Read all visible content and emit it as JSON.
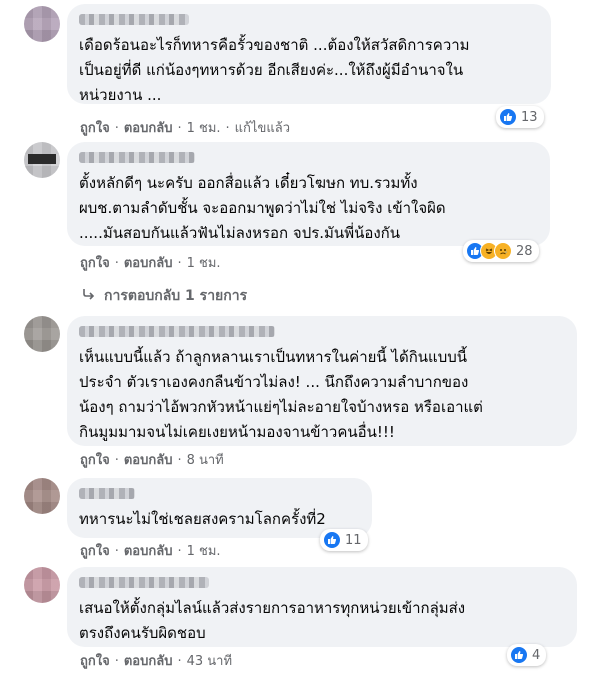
{
  "colors": {
    "bubble": "#f0f2f5",
    "secondary_text": "#65676b",
    "like_blue": "#1877f2",
    "emoji_yellow": "#f7b125"
  },
  "actions": {
    "like": "ถูกใจ",
    "reply": "ตอบกลับ",
    "separator": "·"
  },
  "comments": [
    {
      "text": "เดือดร้อนอะไรก็ทหารคือรั้วของชาติ ...ต้องให้สวัสดิการความ\nเป็นอยู่ที่ดี แก่น้องๆทหารด้วย อีกเสียงค่ะ...ให้ถึงผู้มีอำนาจใน\nหน่วยงาน ...",
      "time": "1 ชม.",
      "edited": "แก้ไขแล้ว",
      "reaction_icons": [
        "like-icon"
      ],
      "reaction_count": "13"
    },
    {
      "text": "ตั้งหลักดีๆ นะครับ ออกสื่อแล้ว เดี๋ยวโฆษก ทบ.รวมทั้ง\nผบช.ตามลำดับชั้น จะออกมาพูดว่าไม่ใช่ ไม่จริง เข้าใจผิด\n.....มันสอบกันแล้วฟันไม่ลงหรอก จปร.มันพี่น้องกัน",
      "time": "1 ชม.",
      "reaction_icons": [
        "like-icon",
        "haha-icon",
        "sad-icon"
      ],
      "reaction_count": "28",
      "replies_link": "การตอบกลับ 1 รายการ"
    },
    {
      "text": "เห็นแบบนี้แล้ว ถ้าลูกหลานเราเป็นทหารในค่ายนี้ ได้กินแบบนี้\nประจำ ตัวเราเองคงกลืนข้าวไม่ลง! ... นึกถึงความลำบากของ\nน้องๆ ถามว่าไอ้พวกหัวหน้าแย่ๆไม่ละอายใจบ้างหรอ หรือเอาแต่\nกินมูมมามจนไม่เคยเงยหน้ามองจานข้าวคนอื่น!!!",
      "time": "8 นาที"
    },
    {
      "text": "ทหารนะไม่ใช่เชลยสงครามโลกครั้งที่2",
      "time": "1 ชม.",
      "reaction_icons": [
        "like-icon"
      ],
      "reaction_count": "11"
    },
    {
      "text": "เสนอให้ตั้งกลุ่มไลน์แล้วส่งรายการอาหารทุกหน่วยเข้ากลุ่มส่ง\nตรงถึงคนรับผิดชอบ",
      "time": "43 นาที",
      "reaction_icons": [
        "like-icon"
      ],
      "reaction_count": "4"
    }
  ]
}
